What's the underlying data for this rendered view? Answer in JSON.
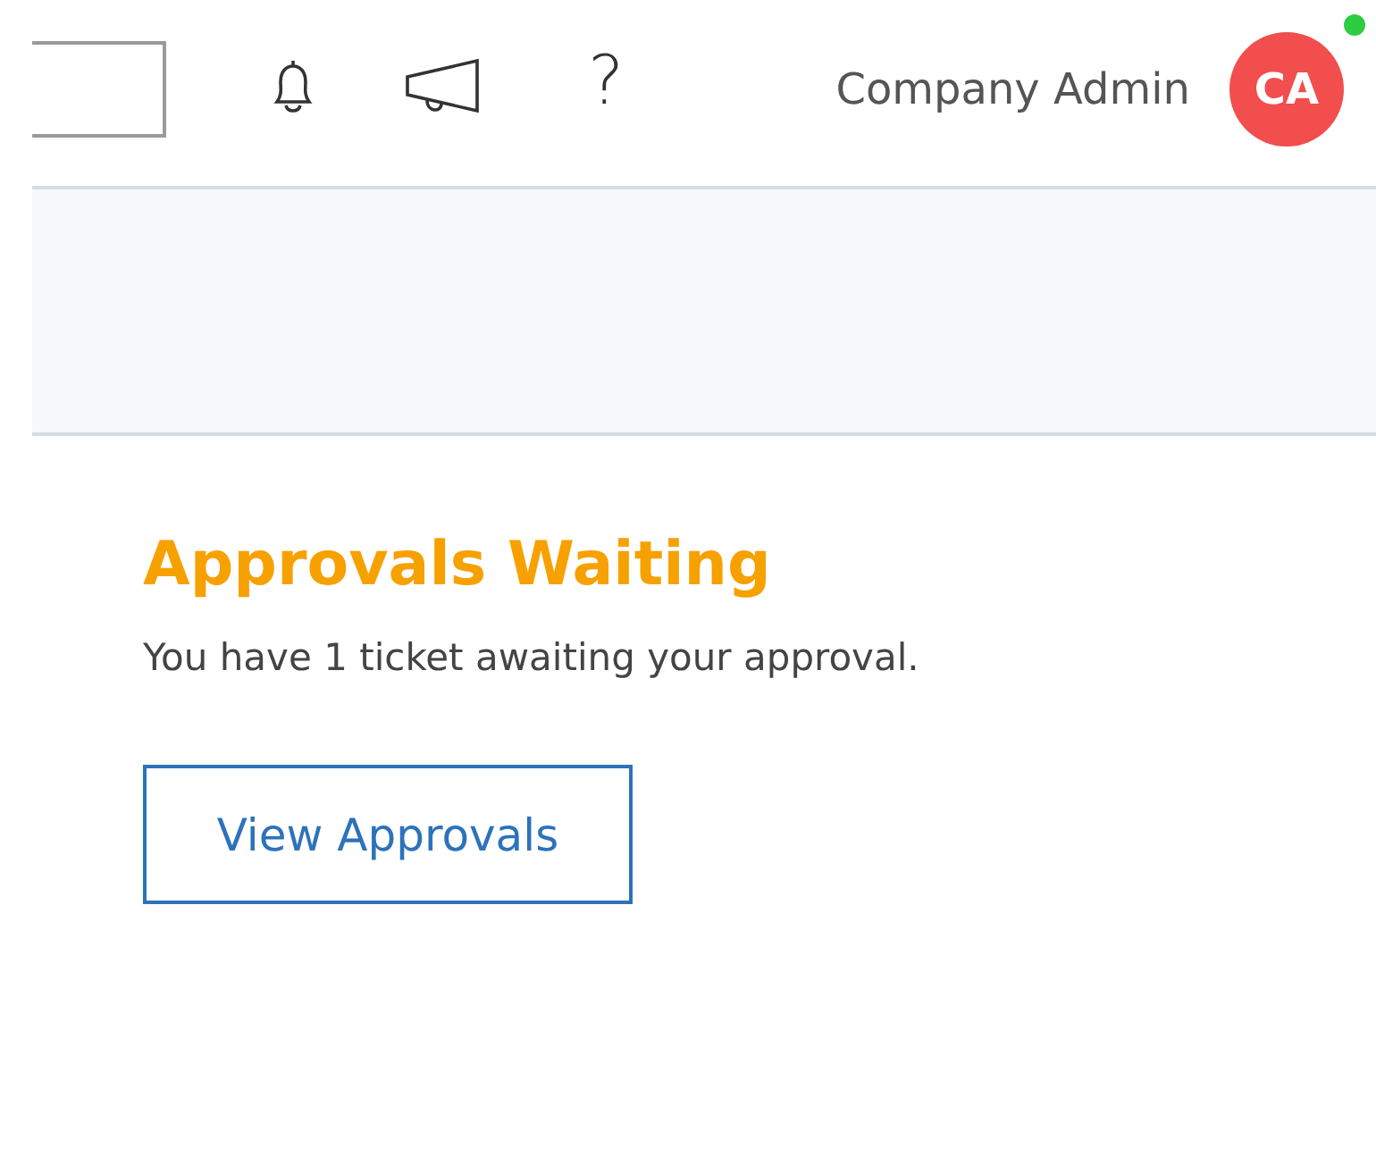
{
  "header": {
    "help": "?",
    "user_name": "Company Admin",
    "avatar_initials": "CA",
    "online": true
  },
  "approvals": {
    "title": "Approvals Waiting",
    "message": "You have 1 ticket awaiting your approval.",
    "button": "View Approvals"
  }
}
